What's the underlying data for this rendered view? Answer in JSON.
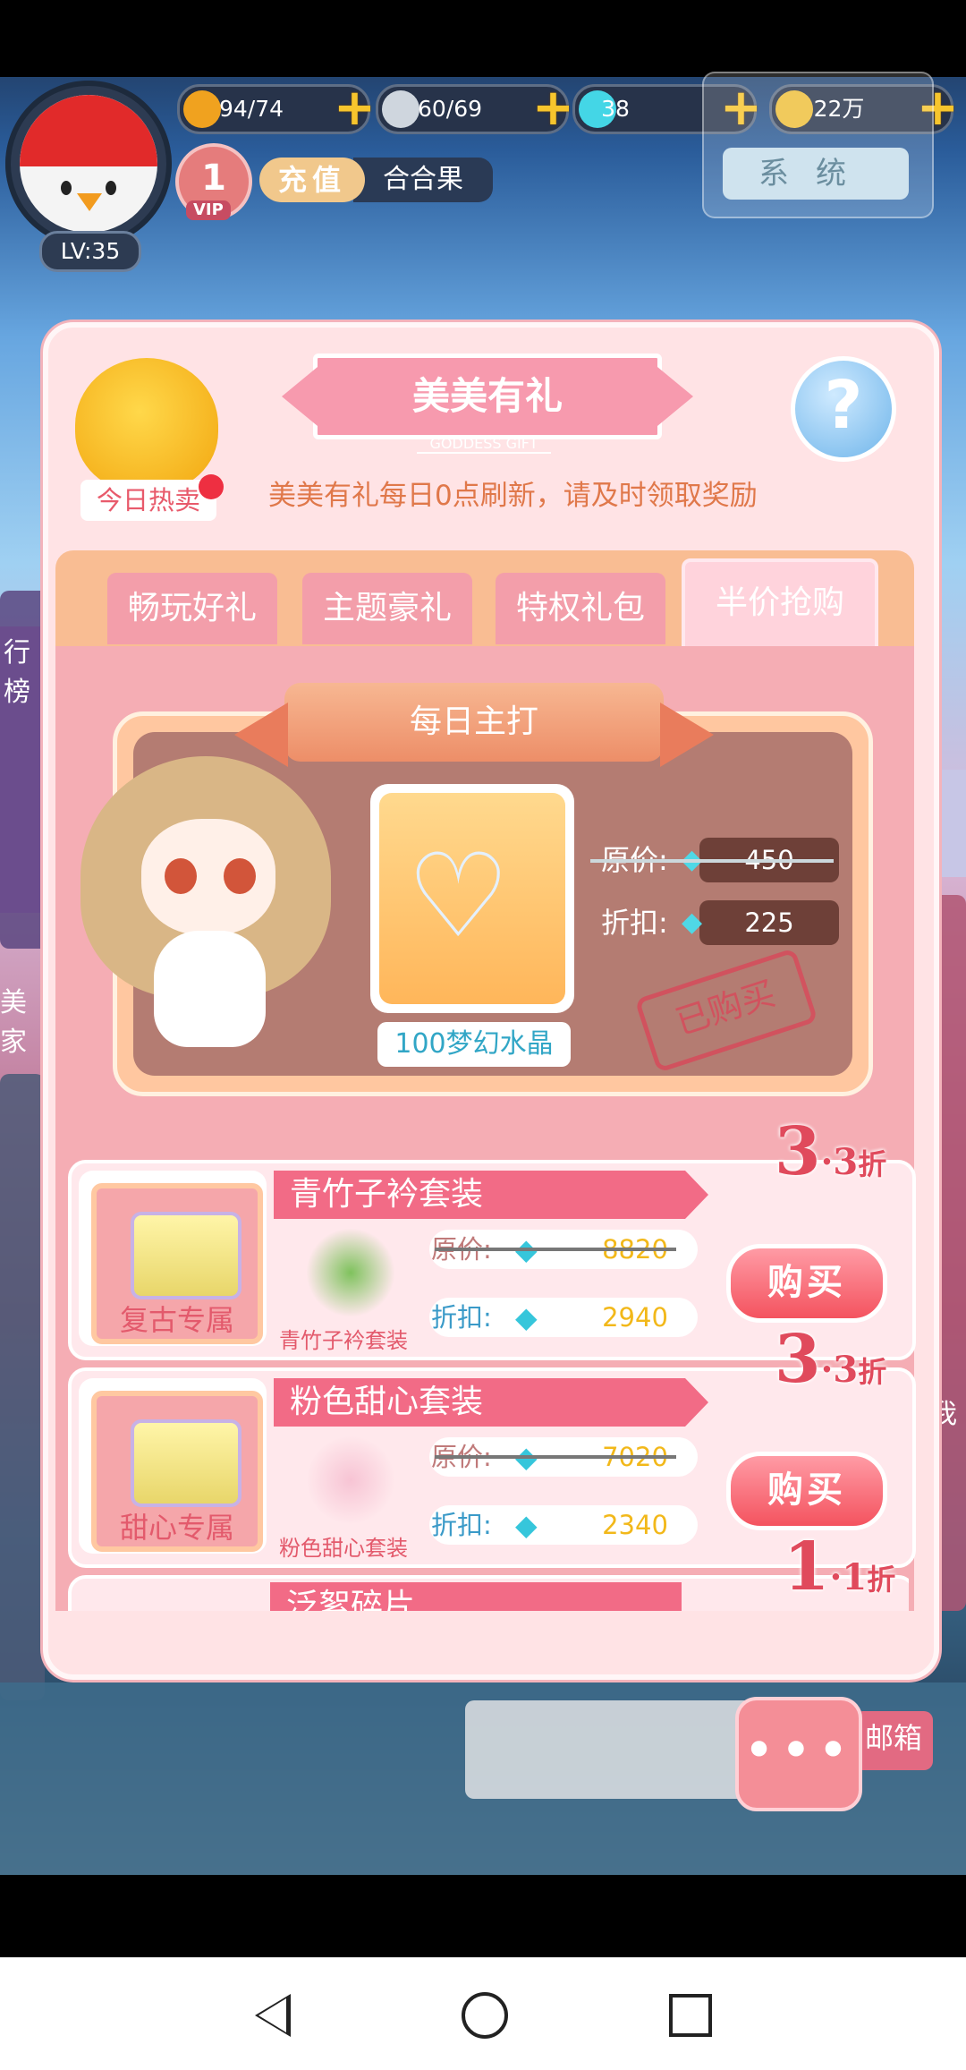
{
  "player": {
    "level": "LV:35",
    "vip_level": "1",
    "vip_label": "VIP",
    "name": "合合果",
    "recharge_label": "充值"
  },
  "resources": [
    {
      "name": "energy",
      "value": "94/74",
      "icon": "lightning-icon"
    },
    {
      "name": "feather",
      "value": "60/69",
      "icon": "feather-icon"
    },
    {
      "name": "diamond",
      "value": "38",
      "icon": "diamond-icon"
    },
    {
      "name": "coin",
      "value": "22万",
      "icon": "coin-icon"
    }
  ],
  "system_button": "系统",
  "popup": {
    "title": "美美有礼",
    "subtitle": "GODDESS GIFT",
    "description": "美美有礼每日0点刷新，请及时领取奖励",
    "hot_sale_label": "今日热卖",
    "tabs": [
      "畅玩好礼",
      "主题豪礼",
      "特权礼包",
      "半价抢购"
    ],
    "active_tab_index": 3,
    "featured": {
      "ribbon": "每日主打",
      "item_name": "100梦幻水晶",
      "original_label": "原价:",
      "original_price": "450",
      "discount_label": "折扣:",
      "discount_price": "225",
      "stamp": "已购买"
    },
    "packages": [
      {
        "category": "复古专属",
        "name": "青竹子衿套装",
        "item_label": "青竹子衿套装",
        "original_label": "原价:",
        "original_price": "8820",
        "discount_label": "折扣:",
        "discount_price": "2940",
        "buy_label": "购买",
        "discount_major": "3",
        "discount_minor": "·3",
        "discount_unit": "折"
      },
      {
        "category": "甜心专属",
        "name": "粉色甜心套装",
        "item_label": "粉色甜心套装",
        "original_label": "原价:",
        "original_price": "7020",
        "discount_label": "折扣:",
        "discount_price": "2340",
        "buy_label": "购买",
        "discount_major": "3",
        "discount_minor": "·3",
        "discount_unit": "折"
      },
      {
        "category": "",
        "name": "泛絮碎片",
        "discount_major": "1",
        "discount_minor": "·1",
        "discount_unit": "折"
      }
    ]
  },
  "side_labels": {
    "left_1": "行榜",
    "left_2": "美家",
    "right_mail": "邮箱",
    "right_me": "我"
  },
  "more_button": "•••"
}
